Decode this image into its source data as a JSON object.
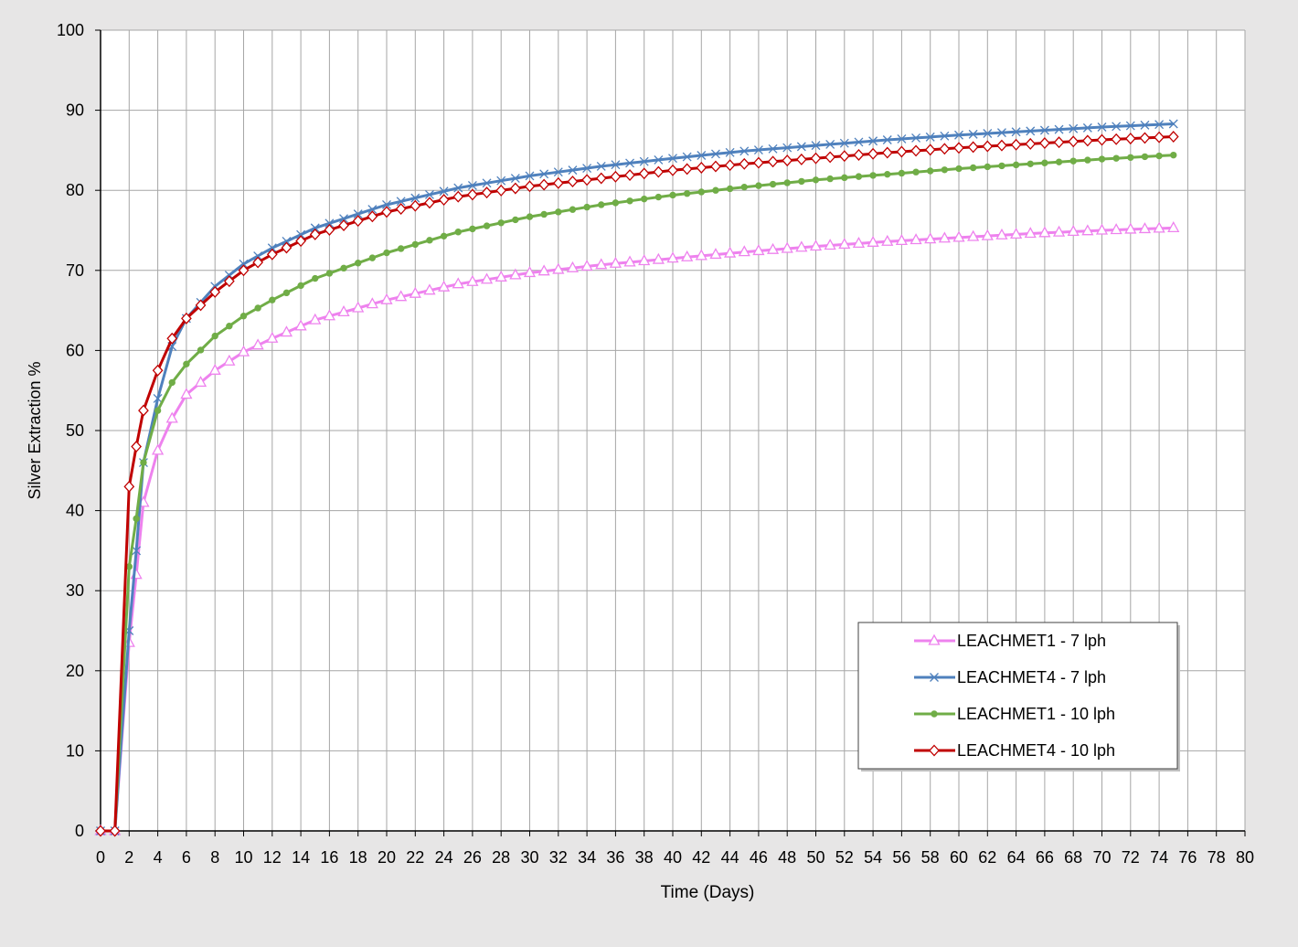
{
  "chart_data": {
    "type": "line",
    "title": "",
    "xlabel": "Time (Days)",
    "ylabel": "Silver Extraction %",
    "xlim": [
      0,
      80
    ],
    "ylim": [
      0,
      100
    ],
    "x_ticks": [
      0,
      2,
      4,
      6,
      8,
      10,
      12,
      14,
      16,
      18,
      20,
      22,
      24,
      26,
      28,
      30,
      32,
      34,
      36,
      38,
      40,
      42,
      44,
      46,
      48,
      50,
      52,
      54,
      56,
      58,
      60,
      62,
      64,
      66,
      68,
      70,
      72,
      74,
      76,
      78,
      80
    ],
    "y_ticks": [
      0,
      10,
      20,
      30,
      40,
      50,
      60,
      70,
      80,
      90,
      100
    ],
    "grid": true,
    "legend_position": "bottom-right",
    "colors": {
      "background": "#e7e6e6",
      "plot_area": "#ffffff",
      "grid": "#a6a6a6",
      "axis": "#000000"
    },
    "series": [
      {
        "name": "LEACHMET1 - 7 lph",
        "color": "#ee82ee",
        "marker": "triangle",
        "anchors": [
          [
            0,
            0
          ],
          [
            1,
            0
          ],
          [
            2,
            23.5
          ],
          [
            2.5,
            32
          ],
          [
            3,
            41
          ],
          [
            4,
            47.5
          ],
          [
            5,
            51.5
          ],
          [
            6,
            54.5
          ],
          [
            8,
            57.5
          ],
          [
            10,
            59.8
          ],
          [
            12,
            61.5
          ],
          [
            15,
            63.8
          ],
          [
            20,
            66.3
          ],
          [
            25,
            68.3
          ],
          [
            30,
            69.7
          ],
          [
            35,
            70.7
          ],
          [
            40,
            71.5
          ],
          [
            45,
            72.3
          ],
          [
            50,
            73.0
          ],
          [
            55,
            73.6
          ],
          [
            60,
            74.1
          ],
          [
            65,
            74.6
          ],
          [
            70,
            75.0
          ],
          [
            75,
            75.3
          ]
        ]
      },
      {
        "name": "LEACHMET4 - 7 lph",
        "color": "#4f81bd",
        "marker": "x",
        "anchors": [
          [
            0,
            0
          ],
          [
            1,
            0
          ],
          [
            2,
            25
          ],
          [
            2.5,
            35
          ],
          [
            3,
            46
          ],
          [
            4,
            54
          ],
          [
            5,
            60.5
          ],
          [
            6,
            64
          ],
          [
            8,
            68
          ],
          [
            10,
            70.8
          ],
          [
            12,
            72.8
          ],
          [
            15,
            75.3
          ],
          [
            20,
            78.2
          ],
          [
            25,
            80.3
          ],
          [
            30,
            81.8
          ],
          [
            35,
            83.0
          ],
          [
            40,
            84.0
          ],
          [
            45,
            84.9
          ],
          [
            50,
            85.6
          ],
          [
            55,
            86.3
          ],
          [
            60,
            86.9
          ],
          [
            65,
            87.4
          ],
          [
            70,
            87.9
          ],
          [
            75,
            88.3
          ]
        ]
      },
      {
        "name": "LEACHMET1 - 10 lph",
        "color": "#70ad47",
        "marker": "circle",
        "anchors": [
          [
            0,
            0
          ],
          [
            1,
            0
          ],
          [
            2,
            33
          ],
          [
            2.5,
            39
          ],
          [
            3,
            46
          ],
          [
            4,
            52.5
          ],
          [
            5,
            56
          ],
          [
            6,
            58.3
          ],
          [
            8,
            61.8
          ],
          [
            10,
            64.3
          ],
          [
            12,
            66.3
          ],
          [
            15,
            69
          ],
          [
            20,
            72.2
          ],
          [
            25,
            74.8
          ],
          [
            30,
            76.7
          ],
          [
            35,
            78.2
          ],
          [
            40,
            79.4
          ],
          [
            45,
            80.4
          ],
          [
            50,
            81.3
          ],
          [
            55,
            82.0
          ],
          [
            60,
            82.7
          ],
          [
            65,
            83.3
          ],
          [
            70,
            83.9
          ],
          [
            75,
            84.4
          ]
        ]
      },
      {
        "name": "LEACHMET4 - 10 lph",
        "color": "#c00000",
        "marker": "diamond",
        "anchors": [
          [
            0,
            0
          ],
          [
            1,
            0
          ],
          [
            2,
            43
          ],
          [
            2.5,
            48
          ],
          [
            3,
            52.5
          ],
          [
            4,
            57.5
          ],
          [
            5,
            61.5
          ],
          [
            6,
            64
          ],
          [
            8,
            67.3
          ],
          [
            10,
            70
          ],
          [
            12,
            72
          ],
          [
            15,
            74.5
          ],
          [
            20,
            77.3
          ],
          [
            25,
            79.2
          ],
          [
            30,
            80.5
          ],
          [
            35,
            81.5
          ],
          [
            40,
            82.5
          ],
          [
            45,
            83.3
          ],
          [
            50,
            84
          ],
          [
            55,
            84.7
          ],
          [
            60,
            85.3
          ],
          [
            65,
            85.8
          ],
          [
            70,
            86.3
          ],
          [
            75,
            86.7
          ]
        ]
      }
    ]
  }
}
